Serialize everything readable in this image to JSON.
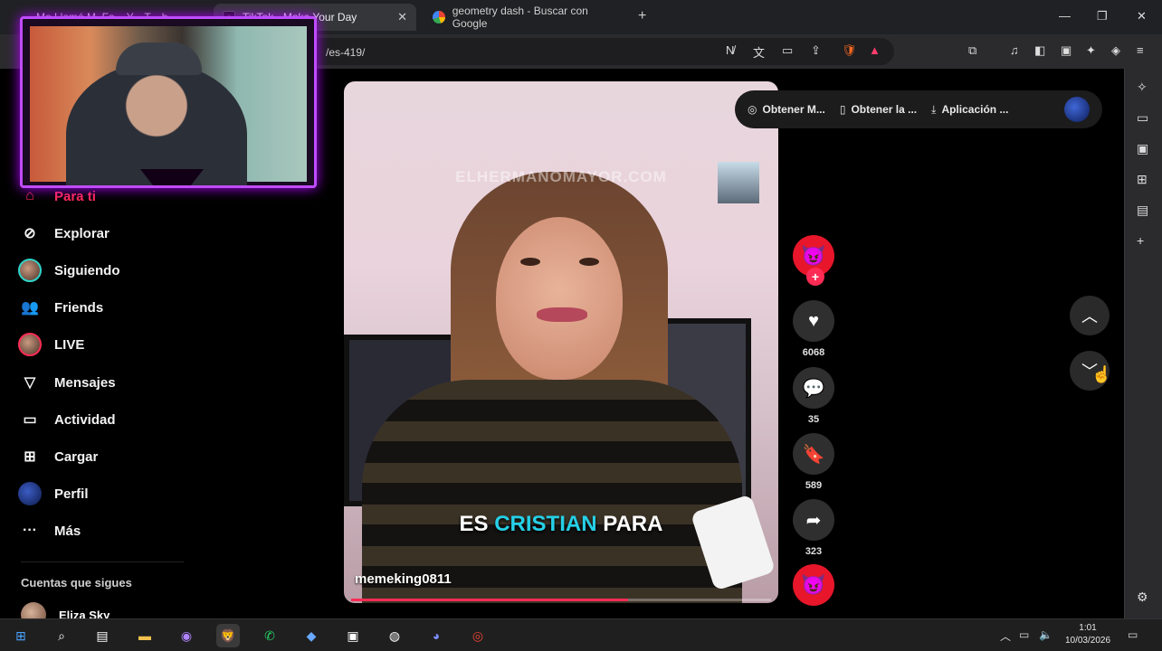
{
  "browser": {
    "tabs": [
      {
        "label": "Mo Llamó M. Fa... Y... T... b...",
        "active": false
      },
      {
        "label": "TikTok - Make Your Day",
        "active": true
      },
      {
        "label": "geometry dash - Buscar con Google",
        "active": false
      }
    ],
    "url": "/es-419/",
    "window_controls": {
      "minimize": "—",
      "maximize": "❐",
      "close": "✕"
    }
  },
  "nav": {
    "items": [
      {
        "label": "Para ti",
        "icon": "home-icon"
      },
      {
        "label": "Explorar",
        "icon": "compass-icon"
      },
      {
        "label": "Siguiendo",
        "icon": "following-avatar"
      },
      {
        "label": "Friends",
        "icon": "friends-icon"
      },
      {
        "label": "LIVE",
        "icon": "live-avatar"
      },
      {
        "label": "Mensajes",
        "icon": "send-icon"
      },
      {
        "label": "Actividad",
        "icon": "activity-icon"
      },
      {
        "label": "Cargar",
        "icon": "upload-icon"
      },
      {
        "label": "Perfil",
        "icon": "profile-avatar"
      },
      {
        "label": "Más",
        "icon": "more-icon"
      }
    ],
    "following_section": "Cuentas que sigues",
    "following": [
      {
        "name": "Eliza Sky"
      }
    ]
  },
  "video": {
    "watermark": "ELHERMANOMAYOR.COM",
    "caption_pre": "ES ",
    "caption_highlight": "CRISTIAN",
    "caption_post": " PARA",
    "username": "memeking0811",
    "progress": 0.66
  },
  "actions": {
    "likes": "6068",
    "comments": "35",
    "saves": "589",
    "shares": "323"
  },
  "getbar": {
    "btn1": "Obtener M...",
    "btn2": "Obtener la ...",
    "btn3": "Aplicación ..."
  },
  "taskbar": {
    "time": "1:01",
    "date": "10/03/2026"
  },
  "colors": {
    "accent": "#fe2c55",
    "caption_highlight": "#25d0e6",
    "webcam_border": "#c04cff"
  }
}
